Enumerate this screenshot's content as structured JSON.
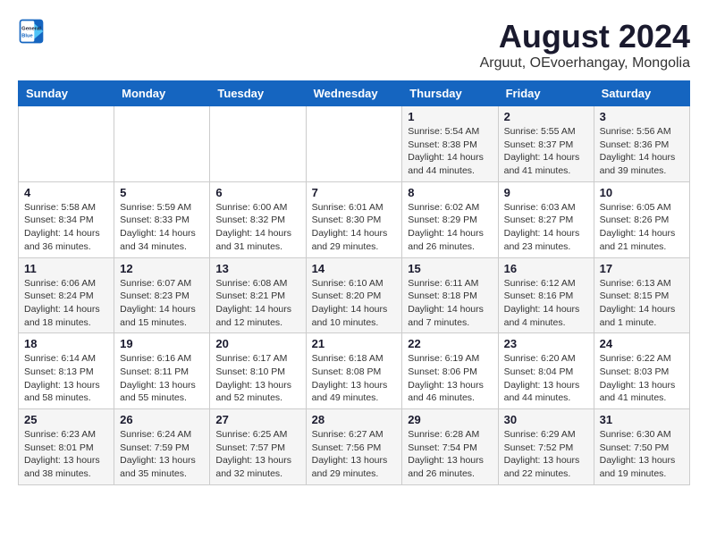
{
  "header": {
    "logo_line1": "General",
    "logo_line2": "Blue",
    "month_year": "August 2024",
    "location": "Arguut, OEvoerhangay, Mongolia"
  },
  "days_of_week": [
    "Sunday",
    "Monday",
    "Tuesday",
    "Wednesday",
    "Thursday",
    "Friday",
    "Saturday"
  ],
  "weeks": [
    [
      {
        "num": "",
        "info": ""
      },
      {
        "num": "",
        "info": ""
      },
      {
        "num": "",
        "info": ""
      },
      {
        "num": "",
        "info": ""
      },
      {
        "num": "1",
        "info": "Sunrise: 5:54 AM\nSunset: 8:38 PM\nDaylight: 14 hours\nand 44 minutes."
      },
      {
        "num": "2",
        "info": "Sunrise: 5:55 AM\nSunset: 8:37 PM\nDaylight: 14 hours\nand 41 minutes."
      },
      {
        "num": "3",
        "info": "Sunrise: 5:56 AM\nSunset: 8:36 PM\nDaylight: 14 hours\nand 39 minutes."
      }
    ],
    [
      {
        "num": "4",
        "info": "Sunrise: 5:58 AM\nSunset: 8:34 PM\nDaylight: 14 hours\nand 36 minutes."
      },
      {
        "num": "5",
        "info": "Sunrise: 5:59 AM\nSunset: 8:33 PM\nDaylight: 14 hours\nand 34 minutes."
      },
      {
        "num": "6",
        "info": "Sunrise: 6:00 AM\nSunset: 8:32 PM\nDaylight: 14 hours\nand 31 minutes."
      },
      {
        "num": "7",
        "info": "Sunrise: 6:01 AM\nSunset: 8:30 PM\nDaylight: 14 hours\nand 29 minutes."
      },
      {
        "num": "8",
        "info": "Sunrise: 6:02 AM\nSunset: 8:29 PM\nDaylight: 14 hours\nand 26 minutes."
      },
      {
        "num": "9",
        "info": "Sunrise: 6:03 AM\nSunset: 8:27 PM\nDaylight: 14 hours\nand 23 minutes."
      },
      {
        "num": "10",
        "info": "Sunrise: 6:05 AM\nSunset: 8:26 PM\nDaylight: 14 hours\nand 21 minutes."
      }
    ],
    [
      {
        "num": "11",
        "info": "Sunrise: 6:06 AM\nSunset: 8:24 PM\nDaylight: 14 hours\nand 18 minutes."
      },
      {
        "num": "12",
        "info": "Sunrise: 6:07 AM\nSunset: 8:23 PM\nDaylight: 14 hours\nand 15 minutes."
      },
      {
        "num": "13",
        "info": "Sunrise: 6:08 AM\nSunset: 8:21 PM\nDaylight: 14 hours\nand 12 minutes."
      },
      {
        "num": "14",
        "info": "Sunrise: 6:10 AM\nSunset: 8:20 PM\nDaylight: 14 hours\nand 10 minutes."
      },
      {
        "num": "15",
        "info": "Sunrise: 6:11 AM\nSunset: 8:18 PM\nDaylight: 14 hours\nand 7 minutes."
      },
      {
        "num": "16",
        "info": "Sunrise: 6:12 AM\nSunset: 8:16 PM\nDaylight: 14 hours\nand 4 minutes."
      },
      {
        "num": "17",
        "info": "Sunrise: 6:13 AM\nSunset: 8:15 PM\nDaylight: 14 hours\nand 1 minute."
      }
    ],
    [
      {
        "num": "18",
        "info": "Sunrise: 6:14 AM\nSunset: 8:13 PM\nDaylight: 13 hours\nand 58 minutes."
      },
      {
        "num": "19",
        "info": "Sunrise: 6:16 AM\nSunset: 8:11 PM\nDaylight: 13 hours\nand 55 minutes."
      },
      {
        "num": "20",
        "info": "Sunrise: 6:17 AM\nSunset: 8:10 PM\nDaylight: 13 hours\nand 52 minutes."
      },
      {
        "num": "21",
        "info": "Sunrise: 6:18 AM\nSunset: 8:08 PM\nDaylight: 13 hours\nand 49 minutes."
      },
      {
        "num": "22",
        "info": "Sunrise: 6:19 AM\nSunset: 8:06 PM\nDaylight: 13 hours\nand 46 minutes."
      },
      {
        "num": "23",
        "info": "Sunrise: 6:20 AM\nSunset: 8:04 PM\nDaylight: 13 hours\nand 44 minutes."
      },
      {
        "num": "24",
        "info": "Sunrise: 6:22 AM\nSunset: 8:03 PM\nDaylight: 13 hours\nand 41 minutes."
      }
    ],
    [
      {
        "num": "25",
        "info": "Sunrise: 6:23 AM\nSunset: 8:01 PM\nDaylight: 13 hours\nand 38 minutes."
      },
      {
        "num": "26",
        "info": "Sunrise: 6:24 AM\nSunset: 7:59 PM\nDaylight: 13 hours\nand 35 minutes."
      },
      {
        "num": "27",
        "info": "Sunrise: 6:25 AM\nSunset: 7:57 PM\nDaylight: 13 hours\nand 32 minutes."
      },
      {
        "num": "28",
        "info": "Sunrise: 6:27 AM\nSunset: 7:56 PM\nDaylight: 13 hours\nand 29 minutes."
      },
      {
        "num": "29",
        "info": "Sunrise: 6:28 AM\nSunset: 7:54 PM\nDaylight: 13 hours\nand 26 minutes."
      },
      {
        "num": "30",
        "info": "Sunrise: 6:29 AM\nSunset: 7:52 PM\nDaylight: 13 hours\nand 22 minutes."
      },
      {
        "num": "31",
        "info": "Sunrise: 6:30 AM\nSunset: 7:50 PM\nDaylight: 13 hours\nand 19 minutes."
      }
    ]
  ]
}
